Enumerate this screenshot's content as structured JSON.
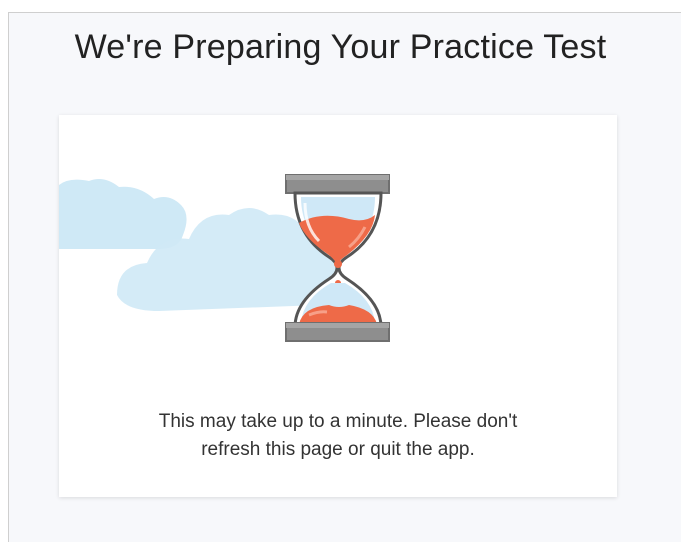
{
  "page": {
    "title": "We're Preparing Your Practice Test"
  },
  "card": {
    "message_line1": "This may take up to a minute. Please don't",
    "message_line2": "refresh this page or quit the app."
  },
  "illustration": {
    "icons": [
      "cloud-icon",
      "hourglass-icon"
    ],
    "colors": {
      "cloud": "#cfe9f6",
      "sand": "#ee6a48",
      "glass": "#cfe8f7",
      "frame": "#8a8a8a"
    }
  }
}
